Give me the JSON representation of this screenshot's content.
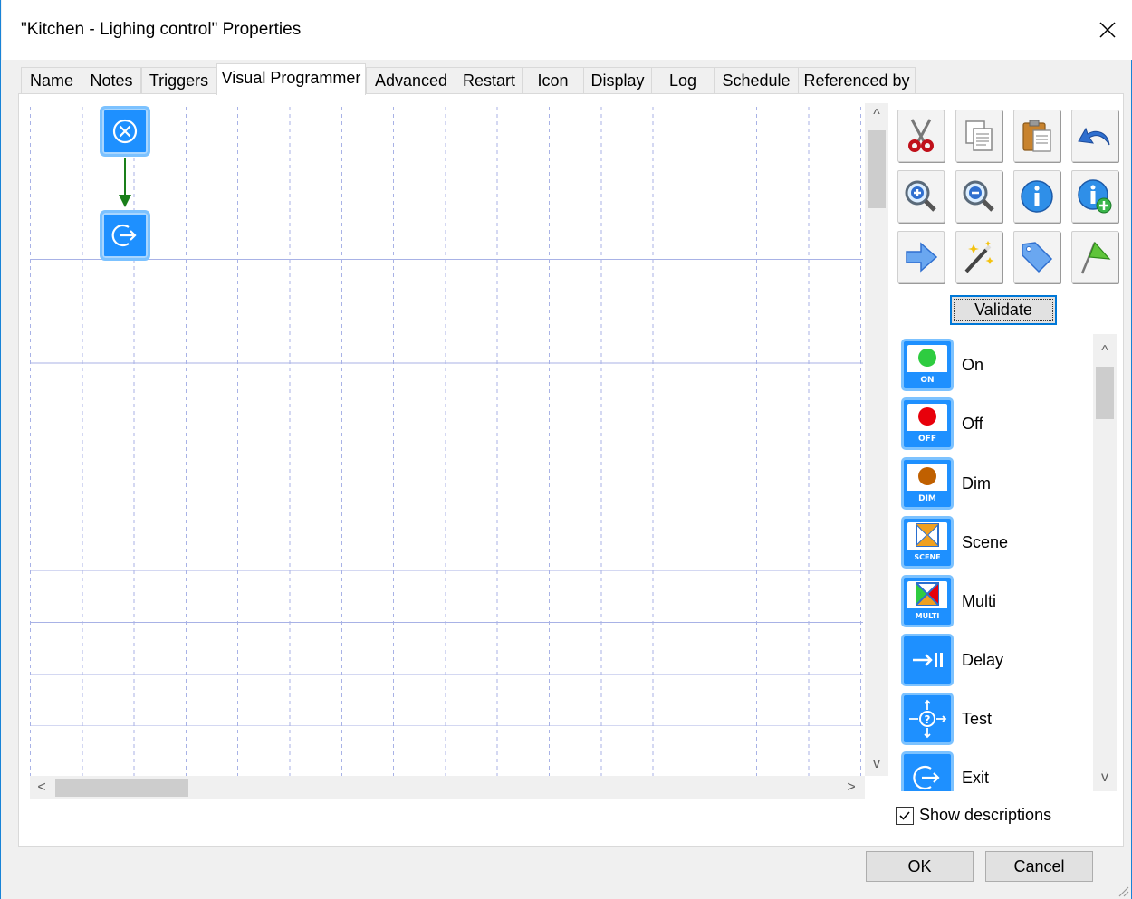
{
  "window": {
    "title": "\"Kitchen - Lighing control\" Properties"
  },
  "tabs": [
    {
      "label": "Name"
    },
    {
      "label": "Notes"
    },
    {
      "label": "Triggers"
    },
    {
      "label": "Visual Programmer",
      "active": true
    },
    {
      "label": "Advanced"
    },
    {
      "label": "Restart"
    },
    {
      "label": "Icon"
    },
    {
      "label": "Display"
    },
    {
      "label": "Log"
    },
    {
      "label": "Schedule"
    },
    {
      "label": "Referenced by"
    }
  ],
  "canvas": {
    "nodes": [
      {
        "icon": "start-x-icon"
      },
      {
        "icon": "exit-icon"
      }
    ],
    "connection_color": "#1a7f1a"
  },
  "toolbar": {
    "buttons": [
      {
        "icon": "cut-icon"
      },
      {
        "icon": "copy-icon"
      },
      {
        "icon": "paste-icon"
      },
      {
        "icon": "undo-icon"
      },
      {
        "icon": "zoom-in-icon"
      },
      {
        "icon": "zoom-out-icon"
      },
      {
        "icon": "info-icon"
      },
      {
        "icon": "info-add-icon"
      },
      {
        "icon": "arrow-right-icon"
      },
      {
        "icon": "magic-wand-icon"
      },
      {
        "icon": "tag-icon"
      },
      {
        "icon": "flag-icon"
      }
    ],
    "validate_label": "Validate"
  },
  "palette": {
    "items": [
      {
        "label": "On",
        "badge": "ON",
        "icon": "on-bulb-icon",
        "color": "#2ecc40"
      },
      {
        "label": "Off",
        "badge": "OFF",
        "icon": "off-bulb-icon",
        "color": "#e8000b"
      },
      {
        "label": "Dim",
        "badge": "DIM",
        "icon": "dim-bulb-icon",
        "color": "#c06000"
      },
      {
        "label": "Scene",
        "badge": "SCENE",
        "icon": "scene-icon",
        "color": "#2a6fcf"
      },
      {
        "label": "Multi",
        "badge": "MULTI",
        "icon": "multi-icon",
        "color": "#2a6fcf"
      },
      {
        "label": "Delay",
        "badge": "",
        "icon": "delay-icon",
        "color": "#1e90ff"
      },
      {
        "label": "Test",
        "badge": "",
        "icon": "test-icon",
        "color": "#1e90ff"
      },
      {
        "label": "Exit",
        "badge": "",
        "icon": "exit-icon",
        "color": "#1e90ff"
      }
    ],
    "show_descriptions_label": "Show descriptions",
    "show_descriptions_checked": true
  },
  "buttons": {
    "ok": "OK",
    "cancel": "Cancel"
  },
  "colors": {
    "accent": "#0078d7",
    "node_blue": "#1e90ff",
    "grid": "#a8b2e6"
  }
}
